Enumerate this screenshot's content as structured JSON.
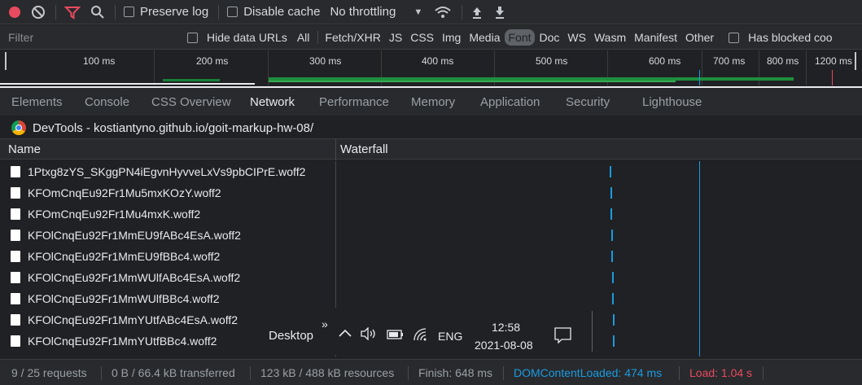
{
  "colors": {
    "record": "#e84a5f",
    "filter_active": "#e84a5f",
    "dom_loaded": "#1a9be0",
    "load": "#e84a5f",
    "waterfall_marker": "#1a9be0"
  },
  "toolbar": {
    "preserve_log": "Preserve log",
    "disable_cache": "Disable cache",
    "throttling": "No throttling"
  },
  "filterbar": {
    "placeholder": "Filter",
    "hide_data_urls": "Hide data URLs",
    "types": [
      "All",
      "Fetch/XHR",
      "JS",
      "CSS",
      "Img",
      "Media",
      "Font",
      "Doc",
      "WS",
      "Wasm",
      "Manifest",
      "Other"
    ],
    "selected_type": "Font",
    "has_blocked": "Has blocked coo"
  },
  "overview": {
    "ticks": [
      "100 ms",
      "200 ms",
      "300 ms",
      "400 ms",
      "500 ms",
      "600 ms",
      "700 ms",
      "800 ms",
      "1200 ms"
    ]
  },
  "panel_tabs": [
    "Elements",
    "Console",
    "CSS Overview",
    "Network",
    "Performance",
    "Memory",
    "Application",
    "Security",
    "Lighthouse"
  ],
  "active_tab": "Network",
  "title": "DevTools - kostiantyno.github.io/goit-markup-hw-08/",
  "columns": {
    "name": "Name",
    "waterfall": "Waterfall"
  },
  "requests": [
    "1Ptxg8zYS_SKggPN4iEgvnHyvveLxVs9pbCIPrE.woff2",
    "KFOmCnqEu92Fr1Mu5mxKOzY.woff2",
    "KFOmCnqEu92Fr1Mu4mxK.woff2",
    "KFOlCnqEu92Fr1MmEU9fABc4EsA.woff2",
    "KFOlCnqEu92Fr1MmEU9fBBc4.woff2",
    "KFOlCnqEu92Fr1MmWUlfABc4EsA.woff2",
    "KFOlCnqEu92Fr1MmWUlfBBc4.woff2",
    "KFOlCnqEu92Fr1MmYUtfABc4EsA.woff2",
    "KFOlCnqEu92Fr1MmYUtfBBc4.woff2"
  ],
  "taskbar": {
    "desktop": "Desktop",
    "chevron": "»",
    "language": "ENG",
    "time": "12:58",
    "date": "2021-08-08"
  },
  "status": {
    "requests": "9 / 25 requests",
    "transferred": "0 B / 66.4 kB transferred",
    "resources": "123 kB / 488 kB resources",
    "finish": "Finish: 648 ms",
    "dom_loaded": "DOMContentLoaded: 474 ms",
    "load": "Load: 1.04 s"
  }
}
